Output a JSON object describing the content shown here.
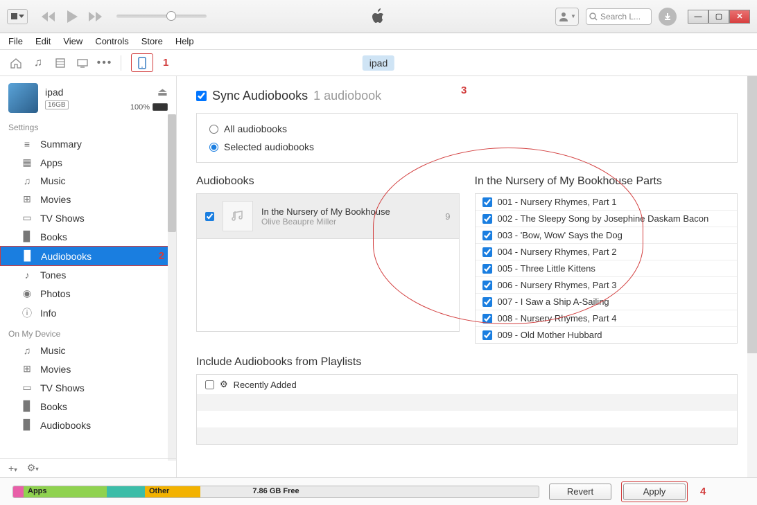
{
  "player": {
    "search_placeholder": "Search L..."
  },
  "menu": [
    "File",
    "Edit",
    "View",
    "Controls",
    "Store",
    "Help"
  ],
  "source_bar": {
    "device_pill": "ipad"
  },
  "callouts": {
    "c1": "1",
    "c2": "2",
    "c3": "3",
    "c4": "4"
  },
  "device": {
    "name": "ipad",
    "capacity": "16GB",
    "battery_pct": "100%"
  },
  "sidebar": {
    "section_settings": "Settings",
    "section_device": "On My Device",
    "settings_items": [
      {
        "icon": "≡",
        "label": "Summary"
      },
      {
        "icon": "▦",
        "label": "Apps"
      },
      {
        "icon": "♫",
        "label": "Music"
      },
      {
        "icon": "⊞",
        "label": "Movies"
      },
      {
        "icon": "▭",
        "label": "TV Shows"
      },
      {
        "icon": "▉",
        "label": "Books"
      },
      {
        "icon": "▉",
        "label": "Audiobooks"
      },
      {
        "icon": "♪",
        "label": "Tones"
      },
      {
        "icon": "◉",
        "label": "Photos"
      },
      {
        "icon": "ⓘ",
        "label": "Info"
      }
    ],
    "device_items": [
      {
        "icon": "♫",
        "label": "Music"
      },
      {
        "icon": "⊞",
        "label": "Movies"
      },
      {
        "icon": "▭",
        "label": "TV Shows"
      },
      {
        "icon": "▉",
        "label": "Books"
      },
      {
        "icon": "▉",
        "label": "Audiobooks"
      }
    ]
  },
  "sync": {
    "title": "Sync Audiobooks",
    "count": "1 audiobook",
    "opt_all": "All audiobooks",
    "opt_selected": "Selected audiobooks"
  },
  "audiobooks": {
    "heading": "Audiobooks",
    "items": [
      {
        "title": "In the Nursery of My Bookhouse",
        "author": "Olive Beaupre Miller",
        "count": "9"
      }
    ]
  },
  "parts": {
    "heading": "In the Nursery of My Bookhouse Parts",
    "items": [
      "001 - Nursery Rhymes, Part 1",
      "002 - The Sleepy Song by Josephine Daskam Bacon",
      "003 - 'Bow, Wow' Says the Dog",
      "004 - Nursery Rhymes, Part 2",
      "005 - Three Little Kittens",
      "006 - Nursery Rhymes, Part 3",
      "007 - I Saw a Ship A-Sailing",
      "008 - Nursery Rhymes, Part 4",
      "009 - Old Mother Hubbard"
    ]
  },
  "playlists": {
    "heading": "Include Audiobooks from Playlists",
    "items": [
      "Recently Added"
    ]
  },
  "storage": {
    "apps_label": "Apps",
    "other_label": "Other",
    "free_label": "7.86 GB Free"
  },
  "footer": {
    "revert": "Revert",
    "apply": "Apply"
  }
}
